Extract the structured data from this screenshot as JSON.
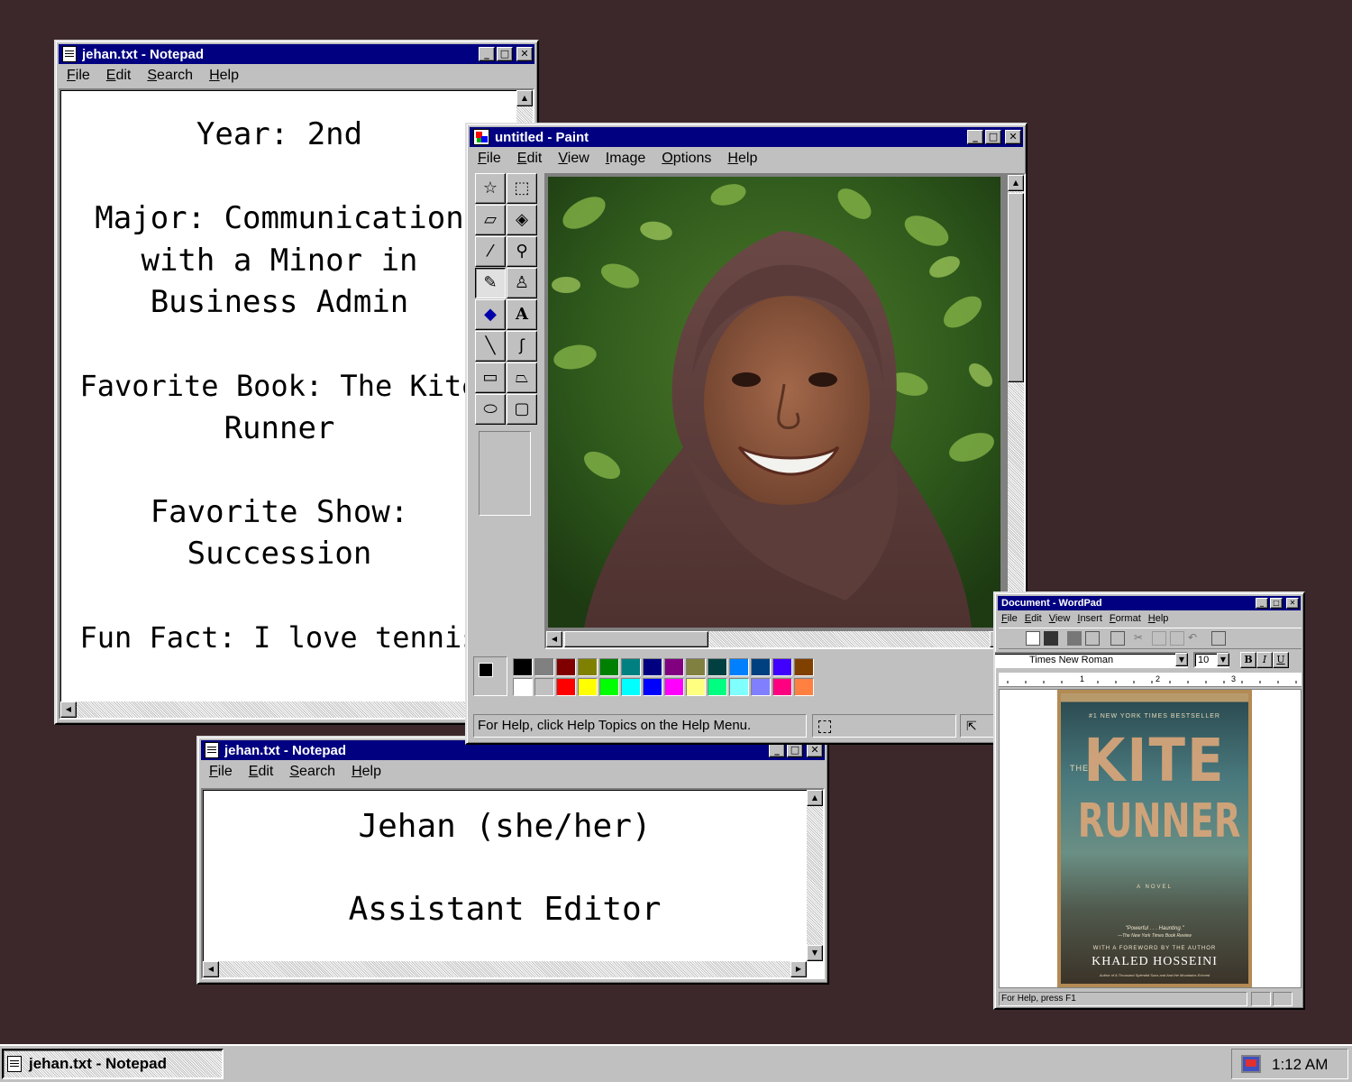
{
  "notepad_main": {
    "title": "jehan.txt - Notepad",
    "menu": [
      "File",
      "Edit",
      "Search",
      "Help"
    ],
    "lines": [
      "Year: 2nd",
      "",
      "Major: Communication",
      "with a Minor in",
      "Business Admin",
      "",
      "Favorite Book: The Kite",
      "Runner",
      "",
      "Favorite Show:",
      "Succession",
      "",
      "Fun Fact: I love tennis"
    ]
  },
  "notepad_small": {
    "title": "jehan.txt - Notepad",
    "menu": [
      "File",
      "Edit",
      "Search",
      "Help"
    ],
    "line1": "Jehan (she/her)",
    "line2": "Assistant Editor"
  },
  "paint": {
    "title": "untitled - Paint",
    "menu": [
      "File",
      "Edit",
      "View",
      "Image",
      "Options",
      "Help"
    ],
    "status": "For Help, click Help Topics on the Help Menu.",
    "palette_top": [
      "#000000",
      "#808080",
      "#800000",
      "#808000",
      "#008000",
      "#008080",
      "#000080",
      "#800080",
      "#808040",
      "#004040",
      "#0080ff",
      "#004080",
      "#4000ff",
      "#804000"
    ],
    "palette_bottom": [
      "#ffffff",
      "#c0c0c0",
      "#ff0000",
      "#ffff00",
      "#00ff00",
      "#00ffff",
      "#0000ff",
      "#ff00ff",
      "#ffff80",
      "#00ff80",
      "#80ffff",
      "#8080ff",
      "#ff0080",
      "#ff8040"
    ]
  },
  "wordpad": {
    "title": "Document - WordPad",
    "menu": [
      "File",
      "Edit",
      "View",
      "Insert",
      "Format",
      "Help"
    ],
    "font": "Times New Roman",
    "size": "10",
    "status": "For Help, press F1",
    "book": {
      "banner": "#1 NEW YORK TIMES BESTSELLER",
      "the": "THE",
      "title1": "KITE",
      "title2": "RUNNER",
      "novel": "A NOVEL",
      "quote": "\"Powerful . . . Haunting.\"",
      "quote_src": "—The New York Times Book Review",
      "foreword": "WITH A FOREWORD BY THE AUTHOR",
      "author": "KHALED HOSSEINI",
      "author_note": "Author of A Thousand Splendid Suns and And the Mountains Echoed"
    }
  },
  "taskbar": {
    "task": "jehan.txt - Notepad",
    "clock": "1:12 AM"
  }
}
